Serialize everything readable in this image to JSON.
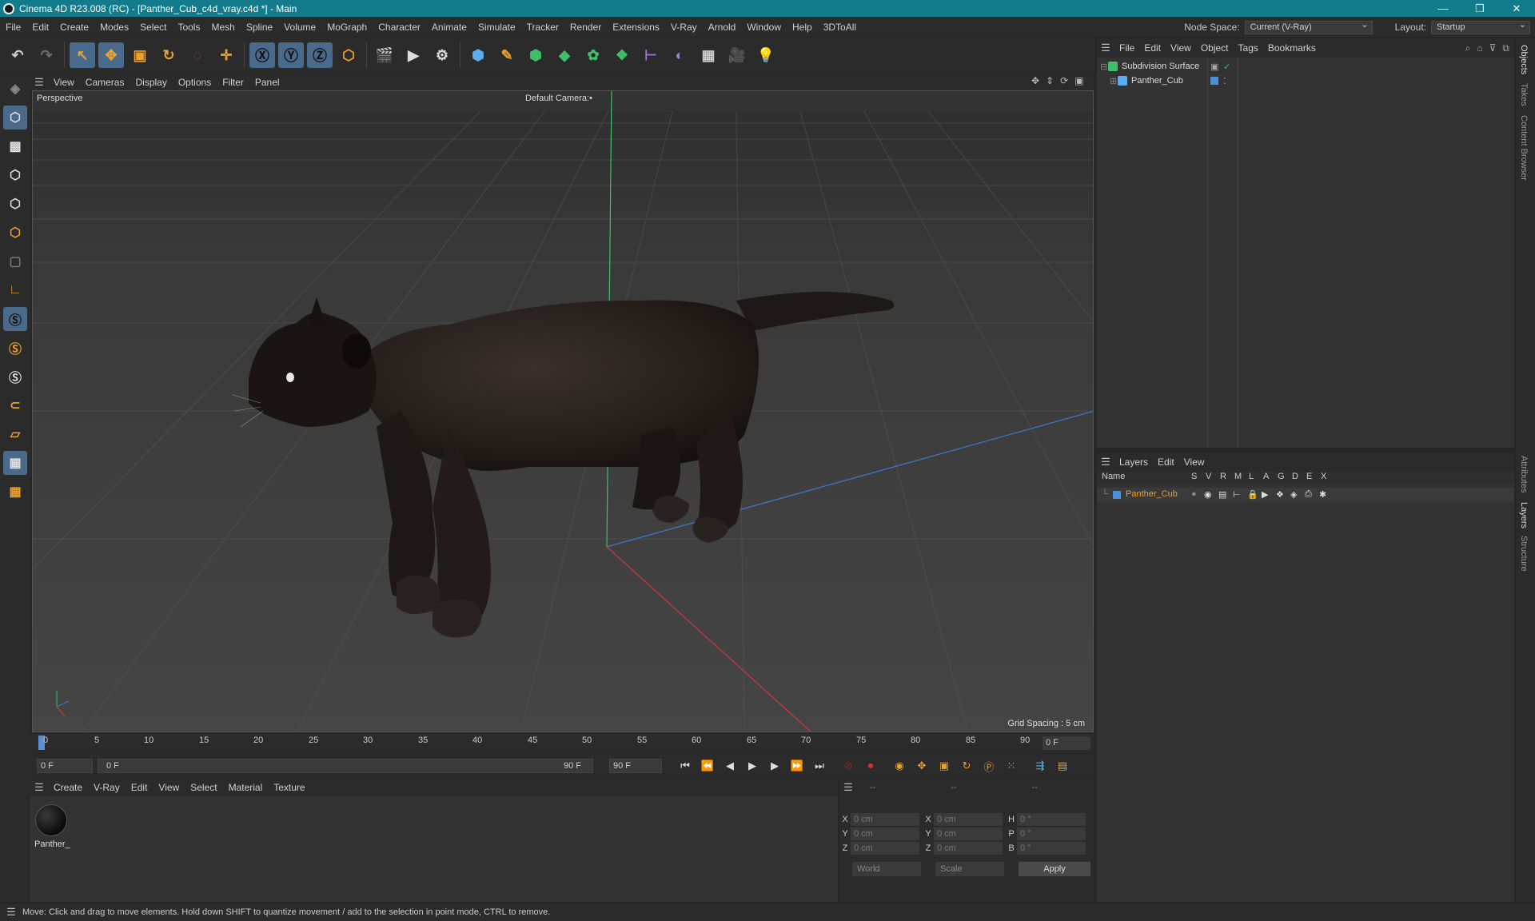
{
  "window": {
    "title": "Cinema 4D R23.008 (RC) - [Panther_Cub_c4d_vray.c4d *] - Main",
    "minimize": "—",
    "restore": "❐",
    "close": "✕"
  },
  "menu": [
    "File",
    "Edit",
    "Create",
    "Modes",
    "Select",
    "Tools",
    "Mesh",
    "Spline",
    "Volume",
    "MoGraph",
    "Character",
    "Animate",
    "Simulate",
    "Tracker",
    "Render",
    "Extensions",
    "V-Ray",
    "Arnold",
    "Window",
    "Help",
    "3DToAll"
  ],
  "node_space": {
    "label": "Node Space:",
    "value": "Current (V-Ray)"
  },
  "layout": {
    "label": "Layout:",
    "value": "Startup"
  },
  "viewport_menu": [
    "View",
    "Cameras",
    "Display",
    "Options",
    "Filter",
    "Panel"
  ],
  "viewport": {
    "label": "Perspective",
    "camera": "Default Camera",
    "camera_suffix": ":•",
    "grid_spacing": "Grid Spacing : 5 cm"
  },
  "timeline": {
    "ticks": [
      "0",
      "5",
      "10",
      "15",
      "20",
      "25",
      "30",
      "35",
      "40",
      "45",
      "50",
      "55",
      "60",
      "65",
      "70",
      "75",
      "80",
      "85",
      "90"
    ],
    "current_frame": "0 F"
  },
  "transport": {
    "start": "0 F",
    "range_start": "0 F",
    "range_end": "90 F",
    "end": "90 F"
  },
  "materials_menu": [
    "Create",
    "V-Ray",
    "Edit",
    "View",
    "Select",
    "Material",
    "Texture"
  ],
  "material": {
    "name": "Panther_"
  },
  "coords": {
    "headers": [
      "--",
      "--",
      "--"
    ],
    "rows": [
      {
        "l1": "X",
        "v1": "0 cm",
        "l2": "X",
        "v2": "0 cm",
        "l3": "H",
        "v3": "0 °"
      },
      {
        "l1": "Y",
        "v1": "0 cm",
        "l2": "Y",
        "v2": "0 cm",
        "l3": "P",
        "v3": "0 °"
      },
      {
        "l1": "Z",
        "v1": "0 cm",
        "l2": "Z",
        "v2": "0 cm",
        "l3": "B",
        "v3": "0 °"
      }
    ],
    "space": "World",
    "mode": "Scale",
    "apply": "Apply"
  },
  "object_manager": {
    "menu": [
      "File",
      "Edit",
      "View",
      "Object",
      "Tags",
      "Bookmarks"
    ],
    "objects": [
      {
        "name": "Subdivision Surface"
      },
      {
        "name": "Panther_Cub"
      }
    ]
  },
  "layer_manager": {
    "menu": [
      "Layers",
      "Edit",
      "View"
    ],
    "columns": [
      "Name",
      "S",
      "V",
      "R",
      "M",
      "L",
      "A",
      "G",
      "D",
      "E",
      "X"
    ],
    "layers": [
      {
        "name": "Panther_Cub",
        "color": "#4a90d9"
      }
    ]
  },
  "side_tabs": [
    "Objects",
    "Takes",
    "Content Browser",
    "Attributes",
    "Layers",
    "Structure"
  ],
  "status": "Move: Click and drag to move elements. Hold down SHIFT to quantize movement / add to the selection in point mode, CTRL to remove.",
  "colors": {
    "titlebar": "#127c8c",
    "accent_orange": "#e8a030",
    "selected_blue": "#4a6a8c",
    "layer_name": "#e8a030"
  }
}
